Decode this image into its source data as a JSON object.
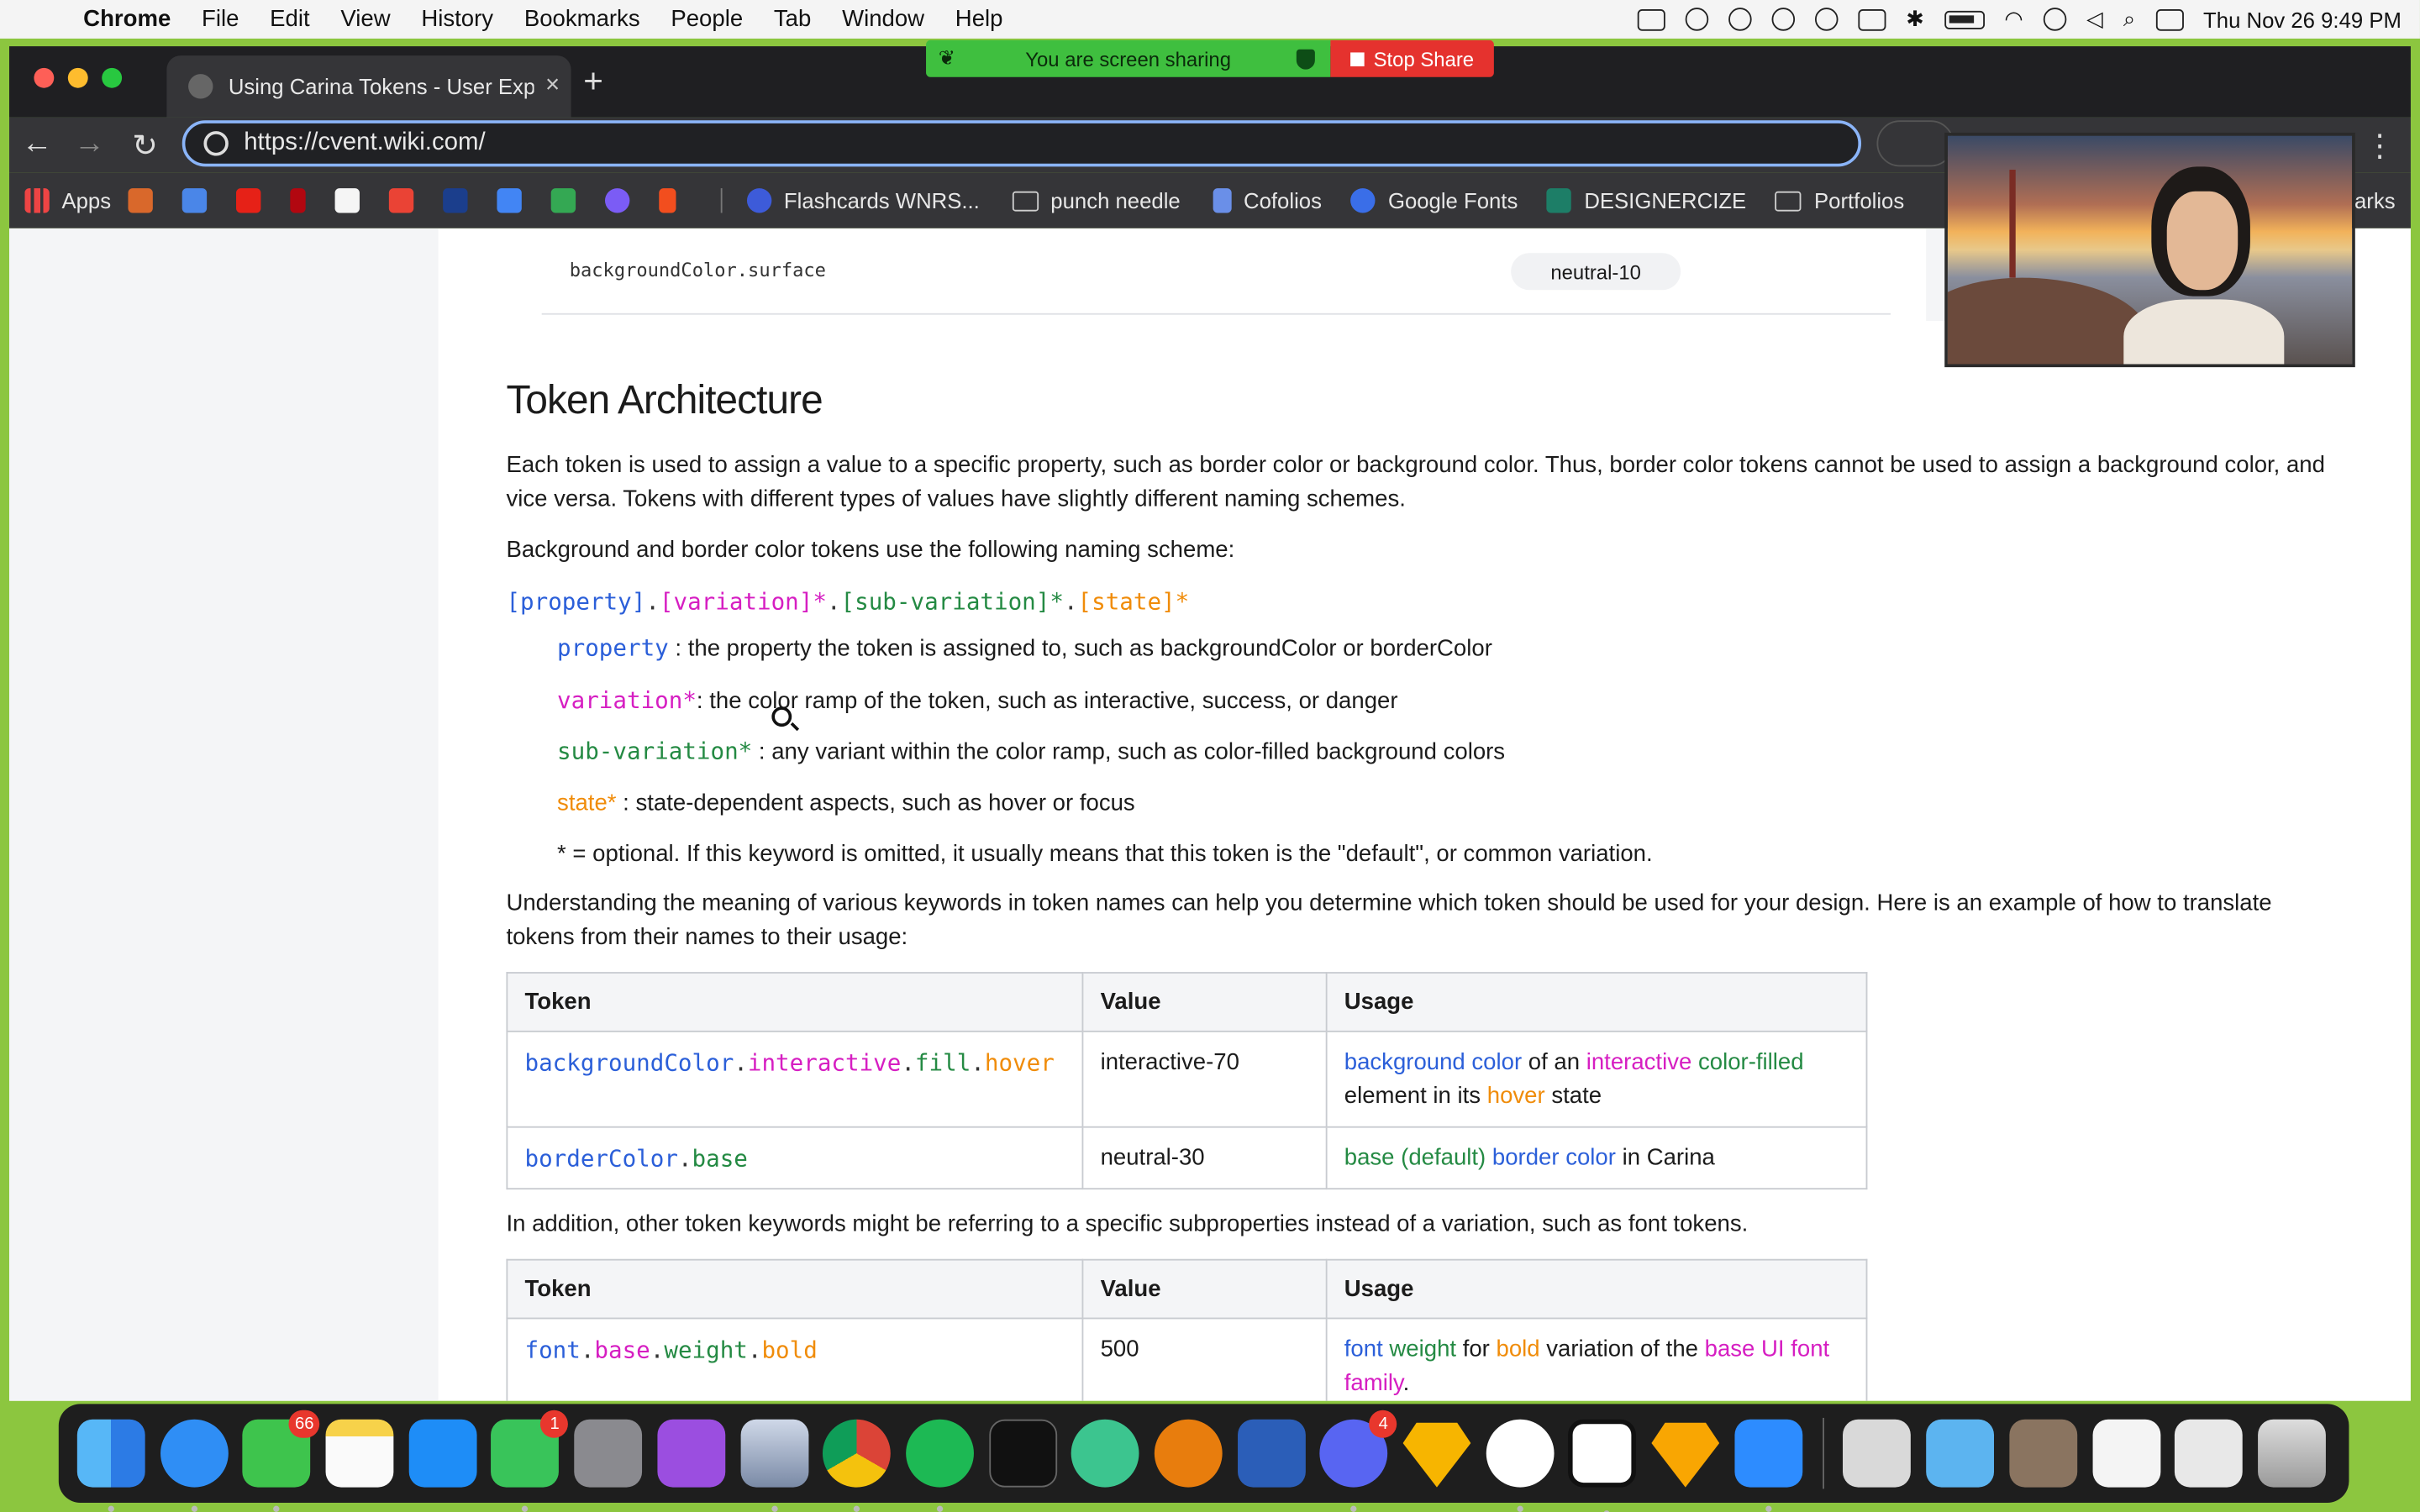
{
  "menubar": {
    "apple": "",
    "app_name": "Chrome",
    "items": [
      "File",
      "Edit",
      "View",
      "History",
      "Bookmarks",
      "People",
      "Tab",
      "Window",
      "Help"
    ],
    "clock": "Thu Nov 26  9:49 PM"
  },
  "screen_share": {
    "status": "You are screen sharing",
    "stop_label": "Stop Share"
  },
  "browser": {
    "tab_title": "Using Carina Tokens - User Exp",
    "tab_close": "×",
    "new_tab": "+",
    "url": "https://cvent.wiki.com/",
    "back": "←",
    "forward": "→",
    "reload": "↻",
    "menu": "⋮",
    "bookmarks": {
      "apps_label": "Apps",
      "flashcards": "Flashcards WNRS...",
      "punch_needle": "punch needle",
      "cofolios": "Cofolios",
      "google_fonts": "Google Fonts",
      "designercize": "DESIGNERCIZE",
      "portfolios": "Portfolios",
      "more": "arks"
    }
  },
  "page": {
    "surface_row": {
      "token": "backgroundColor.surface",
      "value": "neutral-10"
    },
    "heading": "Token Architecture",
    "para1": "Each token is used to assign a value to a specific property, such as border color or background color. Thus, border color tokens cannot be used to assign a background color, and vice versa. Tokens with different types of values have slightly different naming schemes.",
    "para2": "Background and border color tokens use the following naming scheme:",
    "scheme": {
      "property": "[property]",
      "dot1": ".",
      "variation": "[variation]*",
      "dot2": ".",
      "subvariation": "[sub-variation]*",
      "dot3": ".",
      "state": "[state]*"
    },
    "defs": {
      "property_term": "property",
      "property_desc": " : the property the token is assigned to, such as backgroundColor or borderColor",
      "variation_term": "variation*",
      "variation_desc": ": the color ramp of the token, such as interactive, success, or danger",
      "subvariation_term": "sub-variation*",
      "subvariation_desc": " : any variant within the color ramp, such as color-filled background colors",
      "state_term": "state*",
      "state_desc": " : state-dependent aspects, such as hover or focus",
      "optional_note": "* = optional. If this keyword is omitted, it usually means that this token is the \"default\", or common variation."
    },
    "para3": "Understanding the meaning of various keywords in token names can help you determine which token should be used for your design. Here is an example of how to translate tokens from their names to their usage:",
    "table1": {
      "headers": [
        "Token",
        "Value",
        "Usage"
      ],
      "row1": {
        "t1": "backgroundColor",
        "d1": ".",
        "t2": "interactive",
        "d2": ".",
        "t3": "fill",
        "d3": ".",
        "t4": "hover",
        "value": "interactive-70",
        "u1": "background color",
        "u2": " of an ",
        "u3": "interactive",
        "u4": " ",
        "u5": "color-filled",
        "u6": " element in its ",
        "u7": "hover",
        "u8": " state"
      },
      "row2": {
        "t1": "borderColor",
        "d1": ".",
        "t2": "base",
        "value": "neutral-30",
        "u1": "base (default)",
        "u2": " ",
        "u3": "border color",
        "u4": " in Carina"
      }
    },
    "para4": "In addition, other token keywords might be referring to a specific subproperties instead of a variation, such as font tokens.",
    "table2": {
      "headers": [
        "Token",
        "Value",
        "Usage"
      ],
      "row1": {
        "t1": "font",
        "d1": ".",
        "t2": "base",
        "d2": ".",
        "t3": "weight",
        "d3": ".",
        "t4": "bold",
        "value": "500",
        "u1": "font",
        "u2": " ",
        "u3": "weight",
        "u4": " for ",
        "u5": "bold",
        "u6": " variation of the ",
        "u7": "base UI font family",
        "u8": "."
      }
    }
  },
  "dock": {
    "apps": [
      "finder-icon",
      "safari-icon",
      "messages-icon",
      "notes-icon",
      "app-store-icon",
      "facetime-icon",
      "system-preferences-icon",
      "podcasts-icon",
      "preview-icon",
      "chrome-icon",
      "spotify-icon",
      "terminal-icon",
      "atom-icon",
      "blender-icon",
      "word-icon",
      "discord-icon",
      "sketch-icon",
      "slack-icon",
      "notion-icon",
      "sketch-beta-icon",
      "zoom-icon",
      "scanner-icon",
      "folder-icon",
      "photo-icon",
      "png-file-icon",
      "image-file-icon",
      "trash-icon"
    ],
    "messages_badge": "66",
    "facetime_badge": "1",
    "discord_badge": "4"
  },
  "colors": {
    "property": "#2b5fd9",
    "variation": "#d61ec2",
    "subvariation": "#248a43",
    "state": "#f08c0a",
    "desktop": "#8cc63f"
  }
}
